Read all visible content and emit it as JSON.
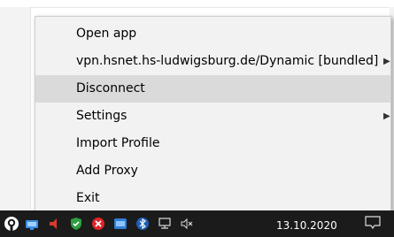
{
  "menu": {
    "items": [
      {
        "label": "Open app",
        "has_submenu": false,
        "highlighted": false
      },
      {
        "label": "vpn.hsnet.hs-ludwigsburg.de/Dynamic [bundled]",
        "has_submenu": true,
        "highlighted": false
      },
      {
        "label": "Disconnect",
        "has_submenu": false,
        "highlighted": true
      },
      {
        "label": "Settings",
        "has_submenu": true,
        "highlighted": false
      },
      {
        "label": "Import Profile",
        "has_submenu": false,
        "highlighted": false
      },
      {
        "label": "Add Proxy",
        "has_submenu": false,
        "highlighted": false
      },
      {
        "label": "Exit",
        "has_submenu": false,
        "highlighted": false
      }
    ]
  },
  "taskbar": {
    "date": "13.10.2020",
    "tray_icons": [
      "openvpn-icon",
      "network-app-icon",
      "speaker-app-icon",
      "security-shield-icon",
      "red-app-icon",
      "blue-app-icon",
      "bluetooth-icon",
      "network-icon",
      "volume-muted-icon"
    ]
  },
  "colors": {
    "menu_bg": "#f2f2f2",
    "highlight": "#dadada",
    "taskbar": "#1b1b1b"
  }
}
